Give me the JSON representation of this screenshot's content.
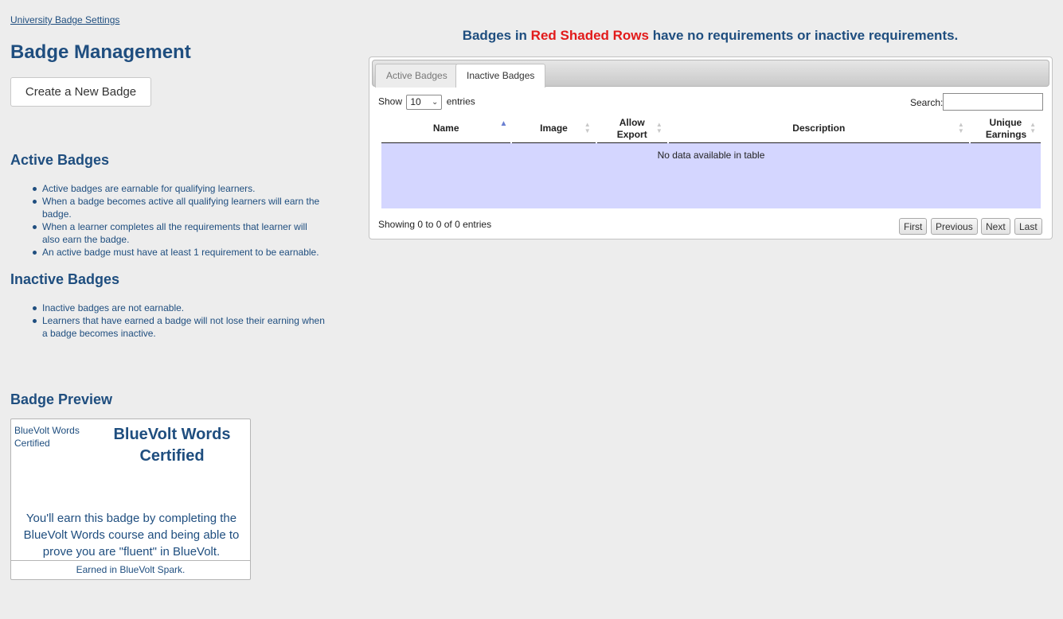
{
  "breadcrumb": "University Badge Settings",
  "page_title": "Badge Management",
  "create_button": "Create a New Badge",
  "active_section": {
    "heading": "Active Badges",
    "notes": [
      "Active badges are earnable for qualifying learners.",
      "When a badge becomes active all qualifying learners will earn the badge.",
      "When a learner completes all the requirements that learner will also earn the badge.",
      "An active badge must have at least 1 requirement to be earnable."
    ]
  },
  "inactive_section": {
    "heading": "Inactive Badges",
    "notes": [
      "Inactive badges are not earnable.",
      "Learners that have earned a badge will not lose their earning when a badge becomes inactive."
    ]
  },
  "preview": {
    "heading": "Badge Preview",
    "small_label": "BlueVolt Words Certified",
    "title": "BlueVolt Words Certified",
    "description": "You'll earn this badge by completing the BlueVolt Words course and being able to prove you are \"fluent\" in BlueVolt.",
    "footer": "Earned in BlueVolt Spark."
  },
  "notice": {
    "prefix": "Badges in ",
    "highlight": "Red Shaded Rows",
    "suffix": " have no requirements or inactive requirements."
  },
  "tabs": [
    "Active Badges",
    "Inactive Badges"
  ],
  "selected_tab": "Inactive Badges",
  "table": {
    "show_label": "Show",
    "page_size": "10",
    "entries_label": "entries",
    "search_label": "Search:",
    "columns": [
      "Name",
      "Image",
      "Allow Export",
      "Description",
      "Unique Earnings"
    ],
    "empty_message": "No data available in table",
    "info": "Showing 0 to 0 of 0 entries",
    "pager": [
      "First",
      "Previous",
      "Next",
      "Last"
    ]
  },
  "colors": {
    "heading": "#1f4e7f",
    "highlight": "#e21a1a",
    "empty_row": "#d4d6ff"
  }
}
